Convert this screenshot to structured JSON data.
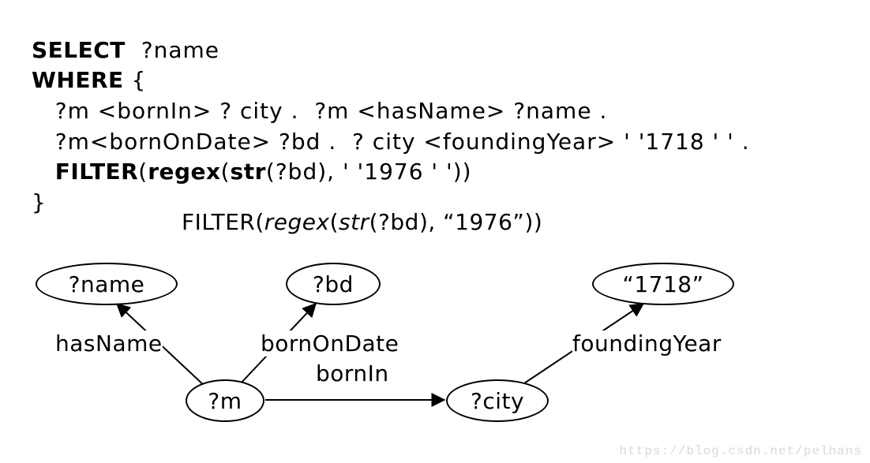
{
  "query": {
    "kw_select": "SELECT",
    "select_vars": "?name",
    "kw_where": "WHERE",
    "brace_open": "{",
    "line1": "   ?m <bornIn> ? city .  ?m <hasName> ?name .",
    "line2": "   ?m<bornOnDate> ?bd .  ? city <foundingYear> ' '1718 ' ' .",
    "kw_filter": "FILTER",
    "filter_open": "(",
    "kw_regex": "regex",
    "regex_open": "(",
    "kw_str": "str",
    "str_args": "(?bd)",
    "filter_rest": ", ' '1976 ' '))",
    "brace_close": "}"
  },
  "filter_text": {
    "word_filter": "FILTER(",
    "word_regex": "regex",
    "paren_open": "(",
    "word_str": "str",
    "str_arg": "(?bd),",
    "spacer": " ",
    "literal": "“1976”",
    "close": "))"
  },
  "nodes": {
    "name": "?name",
    "bd": "?bd",
    "y1718": "“1718”",
    "m": "?m",
    "city": "?city"
  },
  "edges": {
    "hasName": "hasName",
    "bornOnDate": "bornOnDate",
    "bornIn": "bornIn",
    "foundingYear": "foundingYear"
  },
  "watermark": "https://blog.csdn.net/pelhans"
}
